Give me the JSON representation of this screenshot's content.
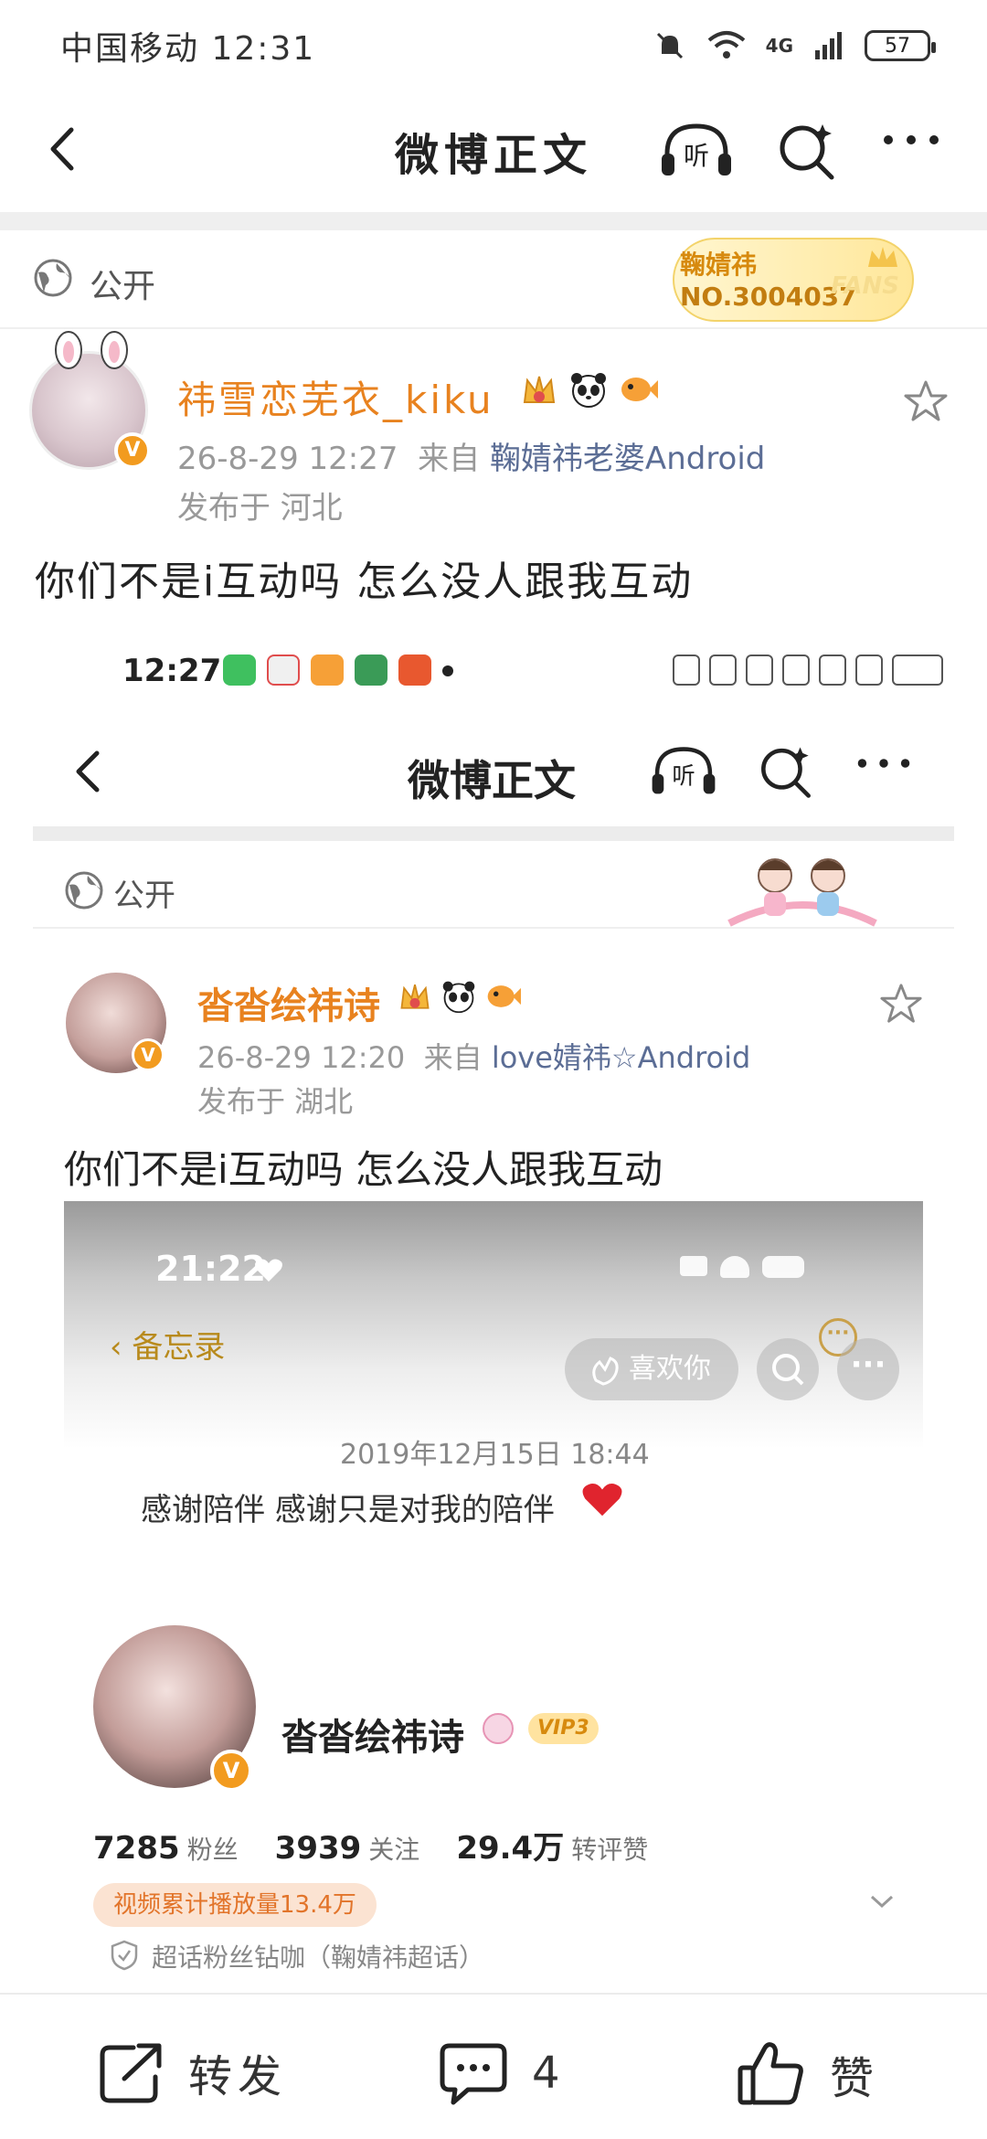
{
  "status_bar": {
    "carrier_time": "中国移动 12:31",
    "network": "4G",
    "battery": "57"
  },
  "nav": {
    "title": "微博正文",
    "listen_label": "听"
  },
  "post": {
    "visibility": "公开",
    "fans_badge": {
      "name": "鞠婧祎",
      "number": "NO.3004037",
      "mark": "FANS"
    },
    "author": "祎雪恋芜衣_kiku",
    "meta_time": "26-8-29 12:27",
    "meta_from": "来自",
    "meta_source": "鞠婧祎老婆Android",
    "location": "发布于 河北",
    "text": "你们不是i互动吗 怎么没人跟我互动"
  },
  "embedded": {
    "status_time": "12:27",
    "nav_title": "微博正文",
    "listen_label": "听",
    "visibility": "公开",
    "author": "沓沓绘祎诗",
    "meta_time": "26-8-29 12:20",
    "meta_from": "来自",
    "meta_source": "love婧祎☆Android",
    "location": "发布于 湖北",
    "text": "你们不是i互动吗 怎么没人跟我互动",
    "inner": {
      "time": "21:22",
      "memo_back": "备忘录",
      "like_label": "喜欢你",
      "date": "2019年12月15日 18:44",
      "note": "感谢陪伴 感谢只是对我的陪伴",
      "name": "沓沓绘祎诗",
      "vip": "VIP3",
      "stats": [
        {
          "num": "7285",
          "label": "粉丝"
        },
        {
          "num": "3939",
          "label": "关注"
        },
        {
          "num": "29.4万",
          "label": "转评赞"
        }
      ],
      "play_count": "视频累计播放量13.4万",
      "topic": "超话粉丝钻咖（鞠婧祎超话）"
    }
  },
  "actions": {
    "repost": "转发",
    "comment_count": "4",
    "like": "赞"
  },
  "colors": {
    "accent_orange": "#e8821f",
    "source_blue": "#5b6d95",
    "verified_badge": "#f29b1f"
  }
}
